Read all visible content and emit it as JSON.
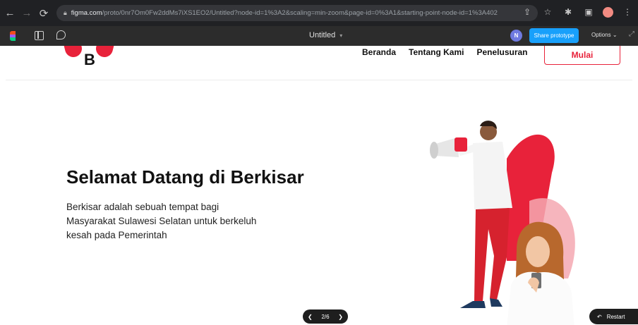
{
  "browser": {
    "url_host": "figma.com",
    "url_path": "/proto/0nr7Om0Fw2ddMs7iXS1EO2/Untitled?node-id=1%3A2&scaling=min-zoom&page-id=0%3A1&starting-point-node-id=1%3A402"
  },
  "figma": {
    "file_title": "Untitled",
    "user_initial": "N",
    "share_label": "Share prototype",
    "options_label": "Options"
  },
  "site": {
    "logo_letter": "B",
    "nav": [
      "Beranda",
      "Tentang Kami",
      "Penelusuran"
    ],
    "cta_label": "Mulai",
    "brand_color": "#e8223a"
  },
  "hero": {
    "title": "Selamat Datang di Berkisar",
    "description": "Berkisar adalah sebuah tempat bagi Masyarakat Sulawesi Selatan untuk berkeluh kesah pada Pemerintah"
  },
  "prototype_controls": {
    "page_indicator": "2/6",
    "restart_label": "Restart"
  }
}
